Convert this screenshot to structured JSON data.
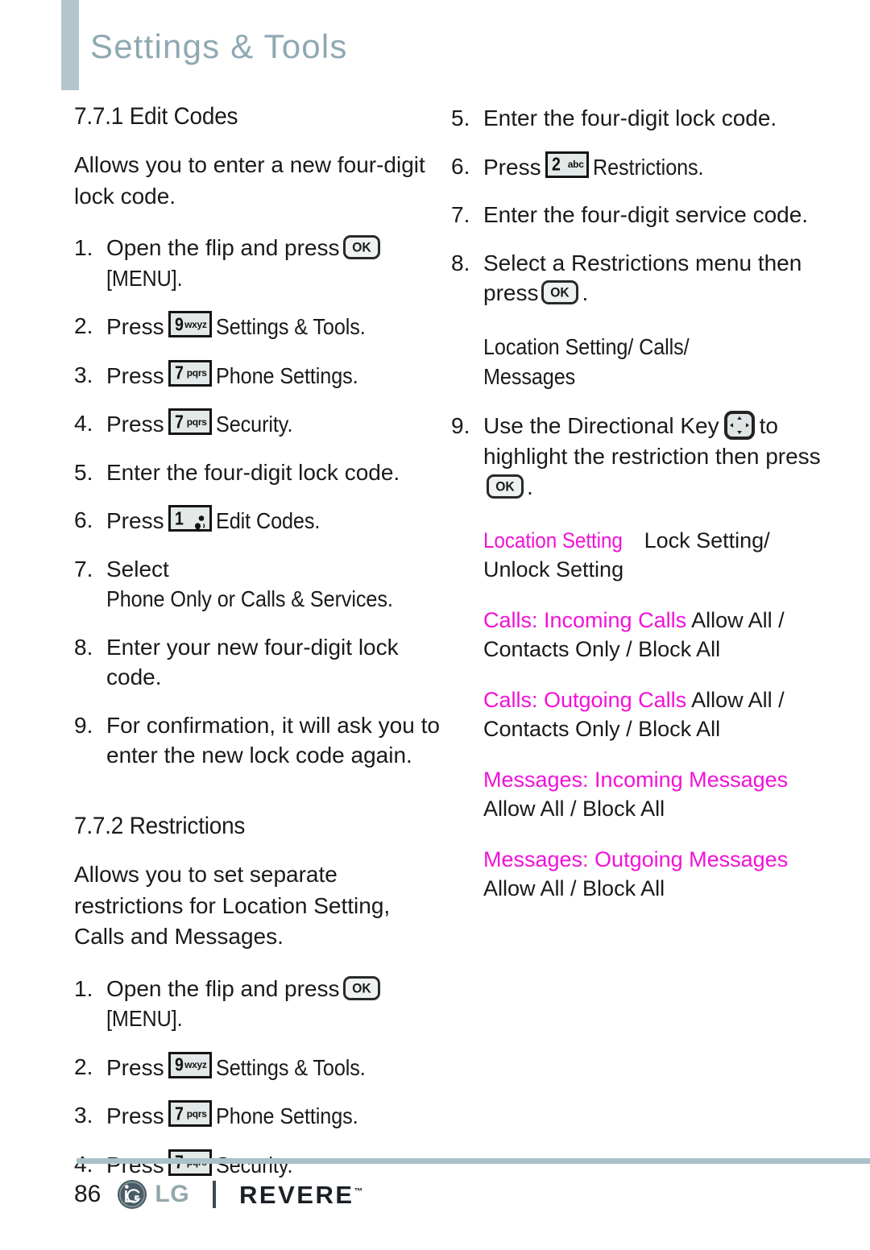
{
  "header": {
    "title": "Settings & Tools"
  },
  "left_column": {
    "section1": {
      "heading": "7.7.1 Edit Codes",
      "intro": "Allows you to enter a new four-digit lock code.",
      "steps": [
        {
          "num": "1.",
          "before": "Open the flip and press",
          "key": "ok",
          "after": "[MENU]."
        },
        {
          "num": "2.",
          "before": "Press",
          "key": "9",
          "key_letters": "wxyz",
          "after": "Settings & Tools."
        },
        {
          "num": "3.",
          "before": "Press",
          "key": "7",
          "key_letters": "pqrs",
          "after": "Phone Settings."
        },
        {
          "num": "4.",
          "before": "Press",
          "key": "7",
          "key_letters": "pqrs",
          "after": "Security."
        },
        {
          "num": "5.",
          "text": "Enter the four-digit lock code."
        },
        {
          "num": "6.",
          "before": "Press",
          "key": "1",
          "key_letters": "voicemail-icon",
          "after": "Edit Codes."
        },
        {
          "num": "7.",
          "text_plain": "Select",
          "text_cond": "Phone Only or Calls & Services."
        },
        {
          "num": "8.",
          "text": "Enter your new four-digit lock code."
        },
        {
          "num": "9.",
          "text": "For confirmation, it will ask you to enter the new lock code again."
        }
      ]
    },
    "section2": {
      "heading": "7.7.2 Restrictions",
      "intro": "Allows you to set separate restrictions for Location Setting, Calls and Messages.",
      "steps": [
        {
          "num": "1.",
          "before": "Open the flip and press",
          "key": "ok",
          "after": "[MENU]."
        },
        {
          "num": "2.",
          "before": "Press",
          "key": "9",
          "key_letters": "wxyz",
          "after": "Settings & Tools."
        },
        {
          "num": "3.",
          "before": "Press",
          "key": "7",
          "key_letters": "pqrs",
          "after": "Phone Settings."
        },
        {
          "num": "4.",
          "before": "Press",
          "key": "7",
          "key_letters": "pqrs",
          "after": "Security."
        }
      ]
    }
  },
  "right_column": {
    "steps_cont": [
      {
        "num": "5.",
        "text": "Enter the four-digit lock code."
      },
      {
        "num": "6.",
        "before": "Press",
        "key": "2",
        "key_letters": "abc",
        "after": "Restrictions."
      },
      {
        "num": "7.",
        "text": "Enter the four-digit service code."
      },
      {
        "num": "8.",
        "before_ok": "Select a Restrictions menu then press",
        "after_ok": "."
      }
    ],
    "options_heading_line1": "Location Setting/ Calls/",
    "options_heading_line2": "Messages",
    "step9": {
      "num": "9.",
      "before_dir": "Use the Directional Key",
      "after_dir": "to highlight the restriction then press",
      "tail": "."
    },
    "options": [
      {
        "label": "Location Setting",
        "values": "Lock Setting/ Unlock Setting"
      },
      {
        "label": "Calls: Incoming Calls",
        "values": "Allow All / Contacts Only / Block All"
      },
      {
        "label": "Calls: Outgoing Calls",
        "values": "Allow All / Contacts Only / Block All"
      },
      {
        "label": "Messages: Incoming Messages",
        "values": "Allow All / Block All"
      },
      {
        "label": "Messages: Outgoing Messages",
        "values": "Allow All / Block All"
      }
    ]
  },
  "footer": {
    "page_number": "86",
    "brand": "LG",
    "product": "REVERE",
    "trademark": "™"
  },
  "colors": {
    "accent_bar": "#b3c6cd",
    "header_text": "#8fa9b2",
    "magenta": "#f112d8",
    "footer_rule": "#a9c1c8"
  }
}
